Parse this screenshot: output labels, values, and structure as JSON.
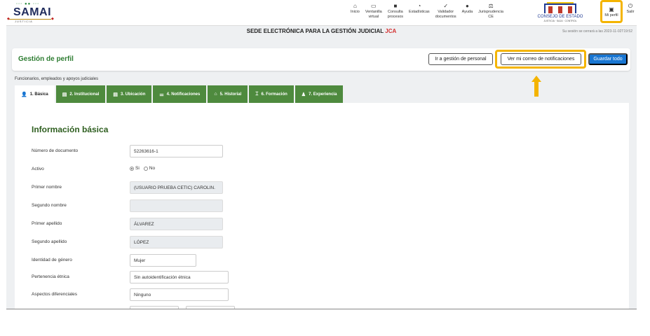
{
  "header": {
    "logo_word": "SAMAI",
    "logo_sub": "JUSTICIA",
    "nav": [
      {
        "icon": "home-icon",
        "glyph": "⌂",
        "label": "Inicio"
      },
      {
        "icon": "ventanilla-icon",
        "glyph": "▭",
        "label": "Ventanilla\nvirtual"
      },
      {
        "icon": "folder-icon",
        "glyph": "■",
        "label": "Consulta\nprocesos"
      },
      {
        "icon": "chart-icon",
        "glyph": "◔",
        "label": "Estadísticas"
      },
      {
        "icon": "validator-icon",
        "glyph": "✓",
        "label": "Validador\ndocumentos"
      },
      {
        "icon": "help-icon",
        "glyph": "●",
        "label": "Ayuda"
      },
      {
        "icon": "balance-icon",
        "glyph": "⚖",
        "label": "Jurisprudencia\nCE"
      }
    ],
    "ce_title": "CONSEJO DE ESTADO",
    "ce_sub": "JUSTICIA · SAJA · CONTROL",
    "profile_label": "Mi perfil",
    "logout_label": "Salir"
  },
  "sede": {
    "title": "SEDE ELECTRÓNICA PARA LA GESTIÓN JUDICIAL",
    "title_accent": "JCA",
    "session": "Su sesión se cerrará a las 2023-11-02T19:52"
  },
  "card": {
    "title": "Gestión de perfil",
    "btn_personal": "Ir a gestión de personal",
    "btn_correo": "Ver mi correo de notificaciones",
    "btn_save": "Guardar todo"
  },
  "section_label": "Funcionarios, empleados y apoyos judiciales",
  "tabs": [
    {
      "glyph": "👤",
      "label": "1. Básica",
      "active": true
    },
    {
      "glyph": "▤",
      "label": "2. Institucional"
    },
    {
      "glyph": "▤",
      "label": "3. Ubicación"
    },
    {
      "glyph": "⚌",
      "label": "4. Notificaciones"
    },
    {
      "glyph": "⌂",
      "label": "5. Historial"
    },
    {
      "glyph": "⌶",
      "label": "6. Formación"
    },
    {
      "glyph": "♟",
      "label": "7. Experiencia"
    }
  ],
  "form": {
    "title": "Información básica",
    "doc_label": "Número de documento",
    "doc_value": "52263616-1",
    "activo_label": "Activo",
    "activo_si": "Si",
    "activo_no": "No",
    "activo_value": "Si",
    "nombre1_label": "Primer nombre",
    "nombre1_value": "(USUARIO PRUEBA CETIC) CAROLIN.",
    "nombre2_label": "Segundo nombre",
    "nombre2_value": "",
    "apellido1_label": "Primer apellido",
    "apellido1_value": "ÁLVAREZ",
    "apellido2_label": "Segundo apellido",
    "apellido2_value": "LÓPEZ",
    "genero_label": "Identidad de género",
    "genero_value": "Mujer",
    "etnica_label": "Pertenencia étnica",
    "etnica_value": "Sin autoidentificación étnica",
    "aspectos_label": "Aspectos diferenciales",
    "aspectos_value": "Ninguno"
  }
}
